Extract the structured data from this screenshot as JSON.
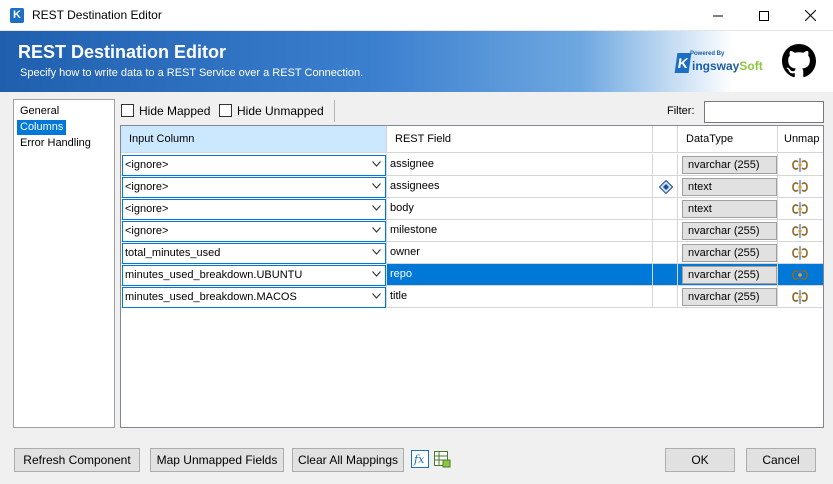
{
  "window": {
    "title": "REST Destination Editor",
    "app_icon_letter": "K"
  },
  "banner": {
    "title": "REST Destination Editor",
    "subtitle": "Specify how to write data to a REST Service over a REST Connection.",
    "logo_powered": "Powered By",
    "logo_k": "K",
    "logo_kingsway": "ingsway",
    "logo_soft": "Soft"
  },
  "nav": {
    "items": [
      "General",
      "Columns",
      "Error Handling"
    ],
    "selected": "Columns"
  },
  "toolbar": {
    "hide_mapped_label": "Hide Mapped",
    "hide_unmapped_label": "Hide Unmapped",
    "filter_label": "Filter:",
    "filter_value": ""
  },
  "grid": {
    "headers": {
      "input_column": "Input Column",
      "rest_field": "REST Field",
      "data_type": "DataType",
      "unmap": "Unmap"
    },
    "rows": [
      {
        "input": "<ignore>",
        "field": "assignee",
        "dtype": "nvarchar (255)",
        "marker": false
      },
      {
        "input": "<ignore>",
        "field": "assignees",
        "dtype": "ntext",
        "marker": true
      },
      {
        "input": "<ignore>",
        "field": "body",
        "dtype": "ntext",
        "marker": false
      },
      {
        "input": "<ignore>",
        "field": "milestone",
        "dtype": "nvarchar (255)",
        "marker": false
      },
      {
        "input": "total_minutes_used",
        "field": "owner",
        "dtype": "nvarchar (255)",
        "marker": false
      },
      {
        "input": "minutes_used_breakdown.UBUNTU",
        "field": "repo",
        "dtype": "nvarchar (255)",
        "marker": false
      },
      {
        "input": "minutes_used_breakdown.MACOS",
        "field": "title",
        "dtype": "nvarchar (255)",
        "marker": false
      }
    ],
    "selected_row": 5
  },
  "buttons": {
    "refresh": "Refresh Component",
    "map_unmapped": "Map Unmapped Fields",
    "clear_all": "Clear All Mappings",
    "ok": "OK",
    "cancel": "Cancel"
  },
  "colors": {
    "accent": "#0078d7",
    "banner_start": "#1f5fae",
    "header_highlight": "#cce8ff"
  }
}
